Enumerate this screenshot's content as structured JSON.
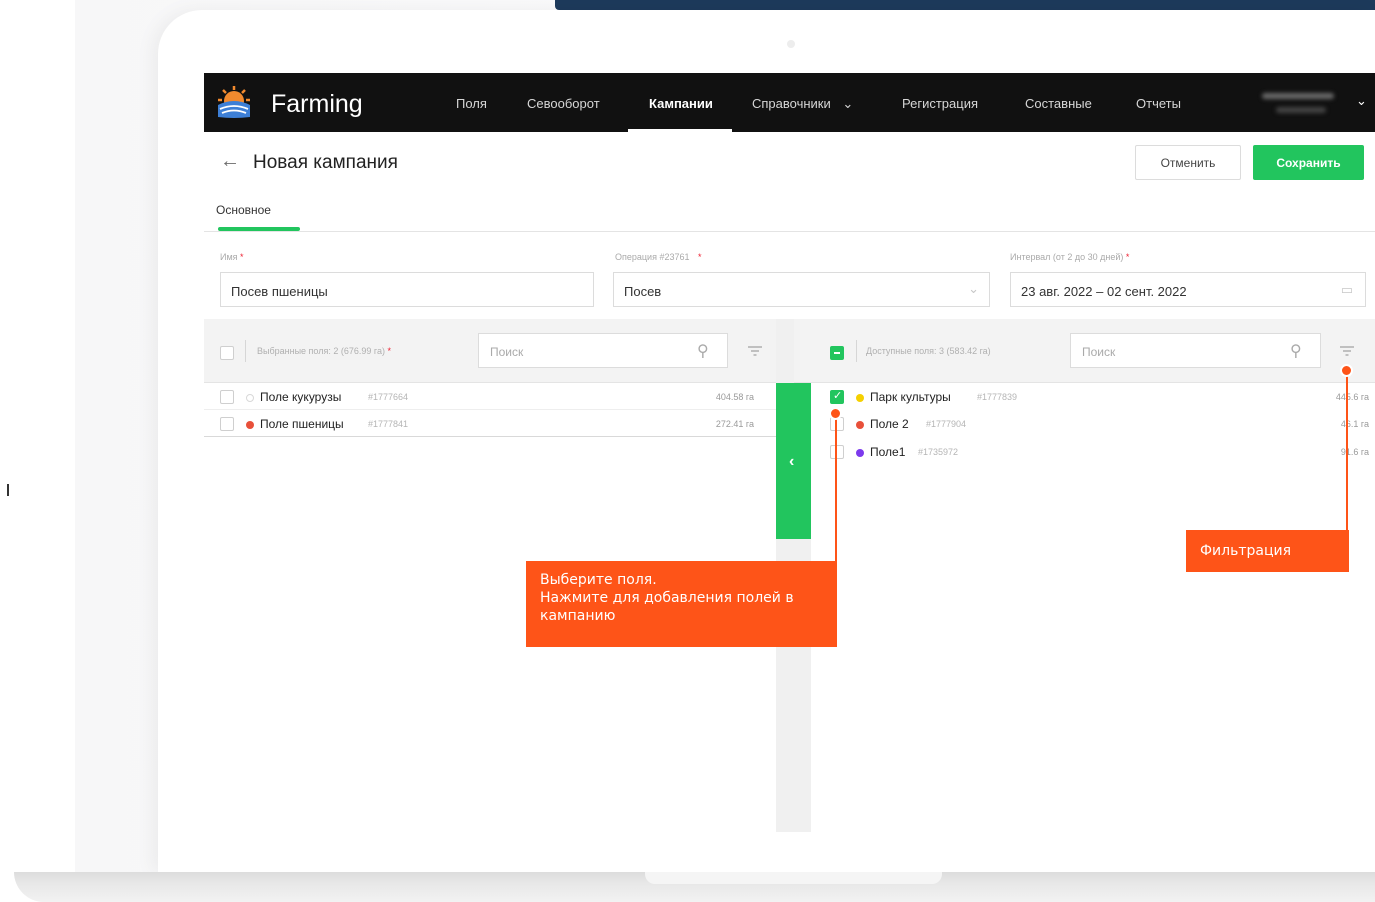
{
  "app": {
    "logo_text": "Farming",
    "nav": [
      {
        "label": "Поля"
      },
      {
        "label": "Севооборот"
      },
      {
        "label": "Кампании"
      },
      {
        "label": "Справочники"
      },
      {
        "label": "Регистрация"
      },
      {
        "label": "Составные"
      },
      {
        "label": "Отчеты"
      }
    ],
    "nav_dropdown_glyph": "⌄",
    "active_nav": "Кампании",
    "user_chevron": "⌄"
  },
  "header": {
    "back_icon": "arrow-left-icon",
    "back_glyph": "←",
    "title": "Новая кампания",
    "cancel_label": "Отменить",
    "save_label": "Сохранить"
  },
  "tabs": [
    {
      "label": "Основное",
      "active": true
    }
  ],
  "form": {
    "name_label": "Имя",
    "name_value": "Посев пшеницы",
    "operation_label": "Операция  #23761",
    "operation_value": "Посев",
    "interval_label": "Интервал (от 2 до 30 дней)",
    "interval_value": "23 авг. 2022 – 02 сент. 2022",
    "required_mark": "*",
    "dropdown_glyph": "⌄",
    "calendar_glyph": "▭"
  },
  "selected_panel": {
    "label": "Выбранные поля: 2 (676.99 га)",
    "search_placeholder": "Поиск",
    "rows": [
      {
        "name": "Поле кукурузы",
        "id": "#1777664",
        "area": "404.58 га",
        "dot": "hollow"
      },
      {
        "name": "Поле пшеницы",
        "id": "#1777841",
        "area": "272.41 га",
        "dot": "#e8503a"
      }
    ]
  },
  "available_panel": {
    "label": "Доступные поля: 3 (583.42 га)",
    "search_placeholder": "Поиск",
    "rows": [
      {
        "name": "Парк культуры",
        "id": "#1777839",
        "area": "445.6 га",
        "dot": "#f5d000",
        "checked": true
      },
      {
        "name": "Поле 2",
        "id": "#1777904",
        "area": "46.1 га",
        "dot": "#e8503a",
        "checked": false
      },
      {
        "name": "Поле1",
        "id": "#1735972",
        "area": "91.6 га",
        "dot": "#7c3aed",
        "checked": false
      }
    ]
  },
  "transfer_glyph": "‹",
  "search_glyph": "⚲",
  "callouts": {
    "select_fields": [
      "Выберите поля.",
      "Нажмите для добавления полей в",
      "кампанию"
    ],
    "filter": "Фильтрация"
  },
  "colors": {
    "accent_green": "#22c55e",
    "callout_orange": "#fe5418",
    "topbar": "#111111"
  }
}
